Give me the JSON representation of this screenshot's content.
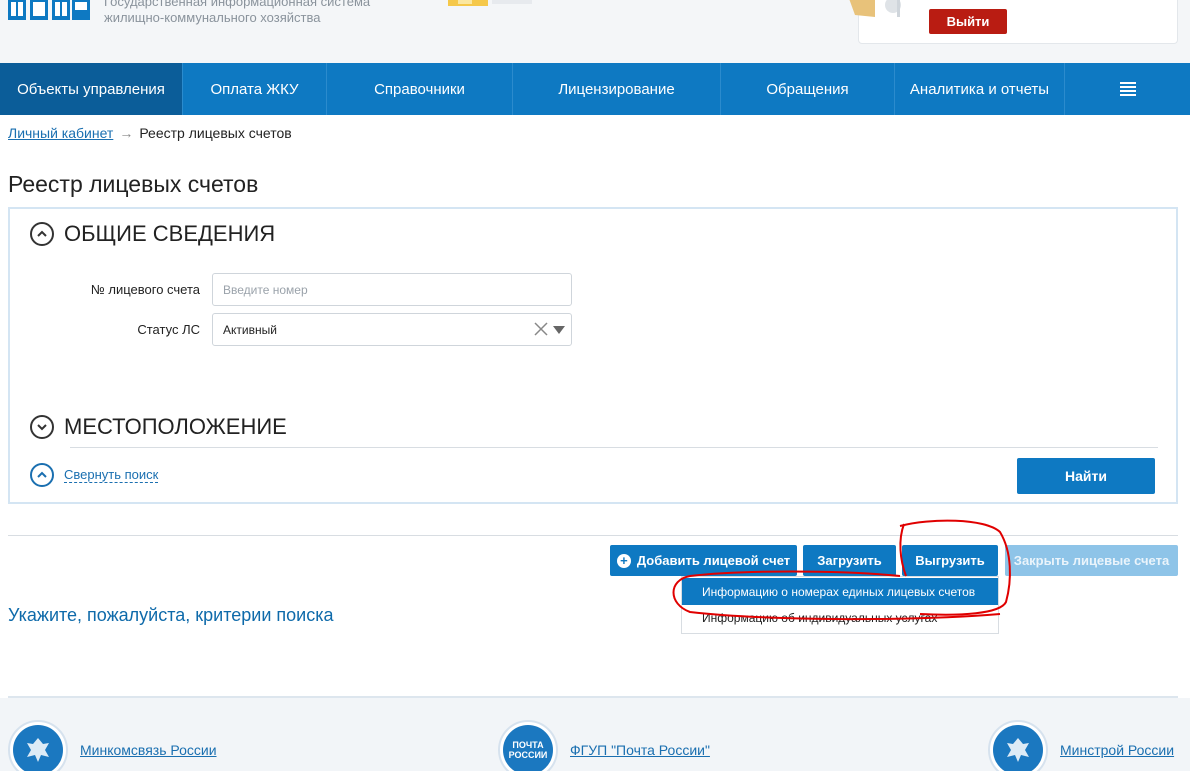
{
  "header": {
    "logo_text_line1": "Государственная информационная система",
    "logo_text_line2": "жилищно-коммунального хозяйства",
    "exit_label": "Выйти"
  },
  "nav": {
    "items": [
      {
        "label": "Объекты управления",
        "active": true
      },
      {
        "label": "Оплата ЖКУ"
      },
      {
        "label": "Справочники"
      },
      {
        "label": "Лицензирование"
      },
      {
        "label": "Обращения"
      },
      {
        "label": "Аналитика и отчеты"
      }
    ],
    "menu_icon": "hamburger-icon"
  },
  "breadcrumb": {
    "root": "Личный кабинет",
    "separator": "→",
    "current": "Реестр лицевых счетов"
  },
  "page_title": "Реестр лицевых счетов",
  "search": {
    "section_general": "ОБЩИЕ СВЕДЕНИЯ",
    "account_label": "№ лицевого счета",
    "account_placeholder": "Введите номер",
    "account_value": "",
    "status_label": "Статус ЛС",
    "status_value": "Активный",
    "section_location": "МЕСТОПОЛОЖЕНИЕ",
    "collapse_label": "Свернуть поиск",
    "find_label": "Найти"
  },
  "actions": {
    "add_label": "Добавить лицевой счет",
    "upload_label": "Загрузить",
    "download_label": "Выгрузить",
    "close_label": "Закрыть лицевые счета"
  },
  "dropdown": {
    "items": [
      {
        "label": "Информацию о номерах единых лицевых счетов",
        "highlighted": true
      },
      {
        "label": "Информацию об индивидуальных услугах"
      }
    ]
  },
  "hint": "Укажите, пожалуйста, критерии поиска",
  "footer": {
    "links": [
      {
        "label": "Минкомсвязь России",
        "icon": "emblem-icon"
      },
      {
        "label": "ФГУП \"Почта России\"",
        "icon": "pochta-logo-icon",
        "emblem_text": "ПОЧТА РОССИИ"
      },
      {
        "label": "Минстрой России",
        "icon": "emblem-icon"
      }
    ]
  },
  "colors": {
    "nav_bg": "#0e79c2",
    "nav_active": "#0b5d99",
    "exit_btn": "#b91c12",
    "annotation": "#e00000"
  }
}
